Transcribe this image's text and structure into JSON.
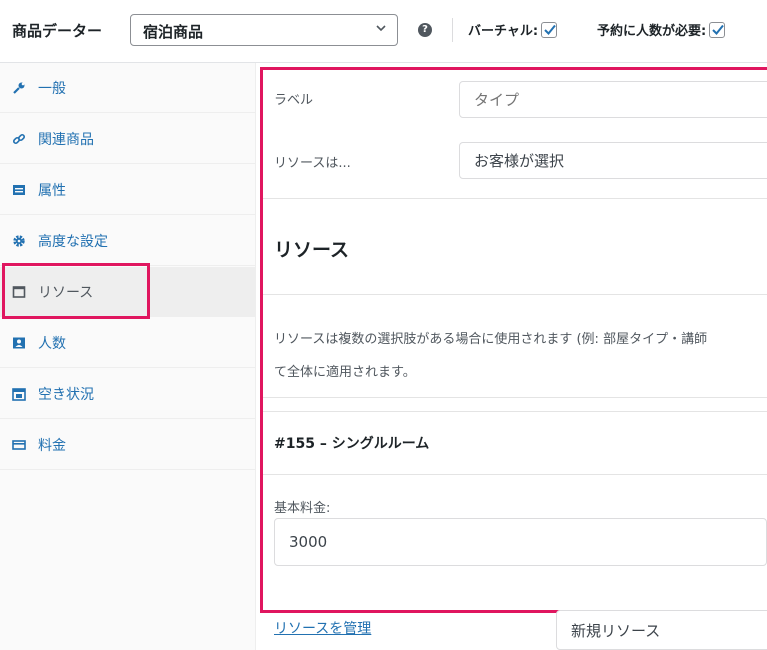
{
  "header": {
    "title": "商品データー",
    "product_type": "宿泊商品",
    "help_icon": "?",
    "virtual_label": "バーチャル:",
    "virtual_checked": true,
    "persons_label": "予約に人数が必要:",
    "persons_checked": true
  },
  "sidebar": {
    "tabs": [
      {
        "label": "一般",
        "icon": "wrench-icon"
      },
      {
        "label": "関連商品",
        "icon": "link-icon"
      },
      {
        "label": "属性",
        "icon": "attributes-icon"
      },
      {
        "label": "高度な設定",
        "icon": "gear-icon"
      },
      {
        "label": "リソース",
        "icon": "resources-icon",
        "active": true
      },
      {
        "label": "人数",
        "icon": "persons-icon"
      },
      {
        "label": "空き状況",
        "icon": "calendar-icon"
      },
      {
        "label": "料金",
        "icon": "money-icon"
      }
    ]
  },
  "main": {
    "label_field": {
      "label": "ラベル",
      "placeholder": "タイプ"
    },
    "resources_are": {
      "label": "リソースは...",
      "value": "お客様が選択"
    },
    "section_title": "リソース",
    "description_line1": "リソースは複数の選択肢がある場合に使用されます (例: 部屋タイプ・講師",
    "description_line2": "て全体に適用されます。",
    "resource": {
      "title": "#155 – シングルルーム",
      "base_cost_label": "基本料金:",
      "base_cost_value": "3000"
    },
    "manage_link": "リソースを管理",
    "new_resource": "新規リソース"
  },
  "colors": {
    "accent": "#2271b1",
    "highlight": "#e0165f"
  }
}
